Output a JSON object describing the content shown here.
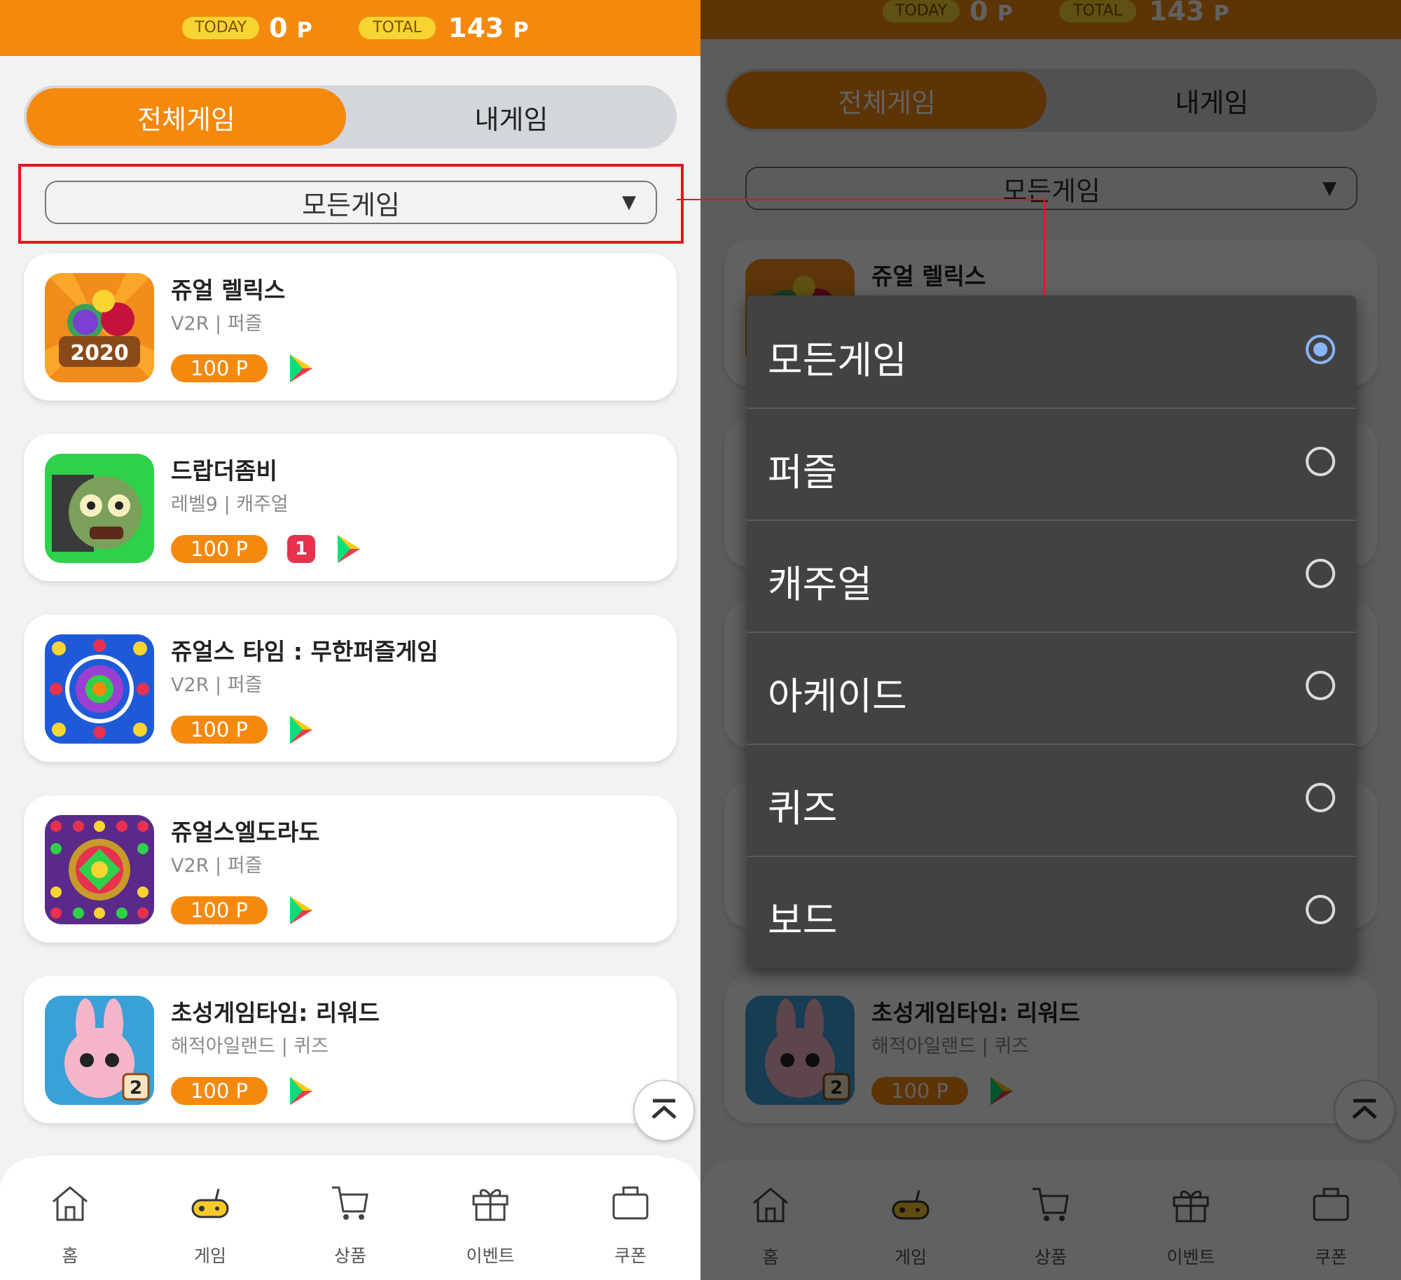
{
  "header": {
    "today_label": "TODAY",
    "today_value": "0",
    "total_label": "TOTAL",
    "total_value": "143",
    "unit": "P"
  },
  "tabs": {
    "all_games": "전체게임",
    "my_games": "내게임"
  },
  "filter": {
    "selected": "모든게임",
    "arrow": "▼"
  },
  "games": [
    {
      "title": "쥬얼 렐릭스",
      "sub": "V2R | 퍼즐",
      "points": "100 P",
      "badge": "",
      "icon": "jewel-relics-icon"
    },
    {
      "title": "드랍더좀비",
      "sub": "레벨9 | 캐주얼",
      "points": "100 P",
      "badge": "1",
      "icon": "drop-the-zombie-icon"
    },
    {
      "title": "쥬얼스 타임 : 무한퍼즐게임",
      "sub": "V2R | 퍼즐",
      "points": "100 P",
      "badge": "",
      "icon": "jewels-time-icon"
    },
    {
      "title": "쥬얼스엘도라도",
      "sub": "V2R | 퍼즐",
      "points": "100 P",
      "badge": "",
      "icon": "jewels-eldorado-icon"
    },
    {
      "title": "초성게임타임: 리워드",
      "sub": "해적아일랜드 | 퀴즈",
      "points": "100 P",
      "badge": "",
      "icon": "chosung-game-icon"
    }
  ],
  "icon_year": "2020",
  "icon_number": "2",
  "nav": [
    {
      "label": "홈",
      "icon": "home-icon"
    },
    {
      "label": "게임",
      "icon": "gamepad-icon"
    },
    {
      "label": "상품",
      "icon": "cart-icon"
    },
    {
      "label": "이벤트",
      "icon": "gift-icon"
    },
    {
      "label": "쿠폰",
      "icon": "briefcase-icon"
    }
  ],
  "dropdown_options": [
    {
      "label": "모든게임",
      "selected": true
    },
    {
      "label": "퍼즐",
      "selected": false
    },
    {
      "label": "캐주얼",
      "selected": false
    },
    {
      "label": "아케이드",
      "selected": false
    },
    {
      "label": "퀴즈",
      "selected": false
    },
    {
      "label": "보드",
      "selected": false
    }
  ],
  "colors": {
    "accent": "#f5890e",
    "highlight": "#e8141b",
    "radio_on": "#8ab4f8"
  }
}
